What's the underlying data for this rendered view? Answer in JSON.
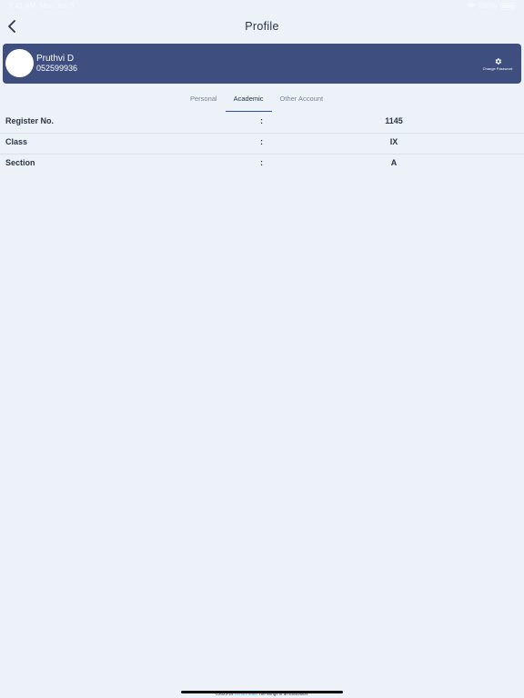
{
  "status_bar": {
    "time": "9:41 AM",
    "date": "Mon Jun 3",
    "battery": "100%"
  },
  "nav": {
    "title": "Profile",
    "back_icon": "chevron-left-icon"
  },
  "profile": {
    "name": "Pruthvi D",
    "id": "052599936",
    "change_password_label": "Change Password",
    "change_password_icon": "gear-icon",
    "card_color": "#3e4f7f"
  },
  "tabs": [
    {
      "label": "Personal",
      "active": false
    },
    {
      "label": "Academic",
      "active": true
    },
    {
      "label": "Other Account",
      "active": false
    }
  ],
  "academic": [
    {
      "label": "Register No.",
      "value": "1145"
    },
    {
      "label": "Class",
      "value": "IX"
    },
    {
      "label": "Section",
      "value": "A"
    }
  ],
  "separator": ":",
  "footer": {
    "copyright": "©2023-24",
    "brand": "School Mate",
    "tagline": "The Wings of an Education."
  }
}
